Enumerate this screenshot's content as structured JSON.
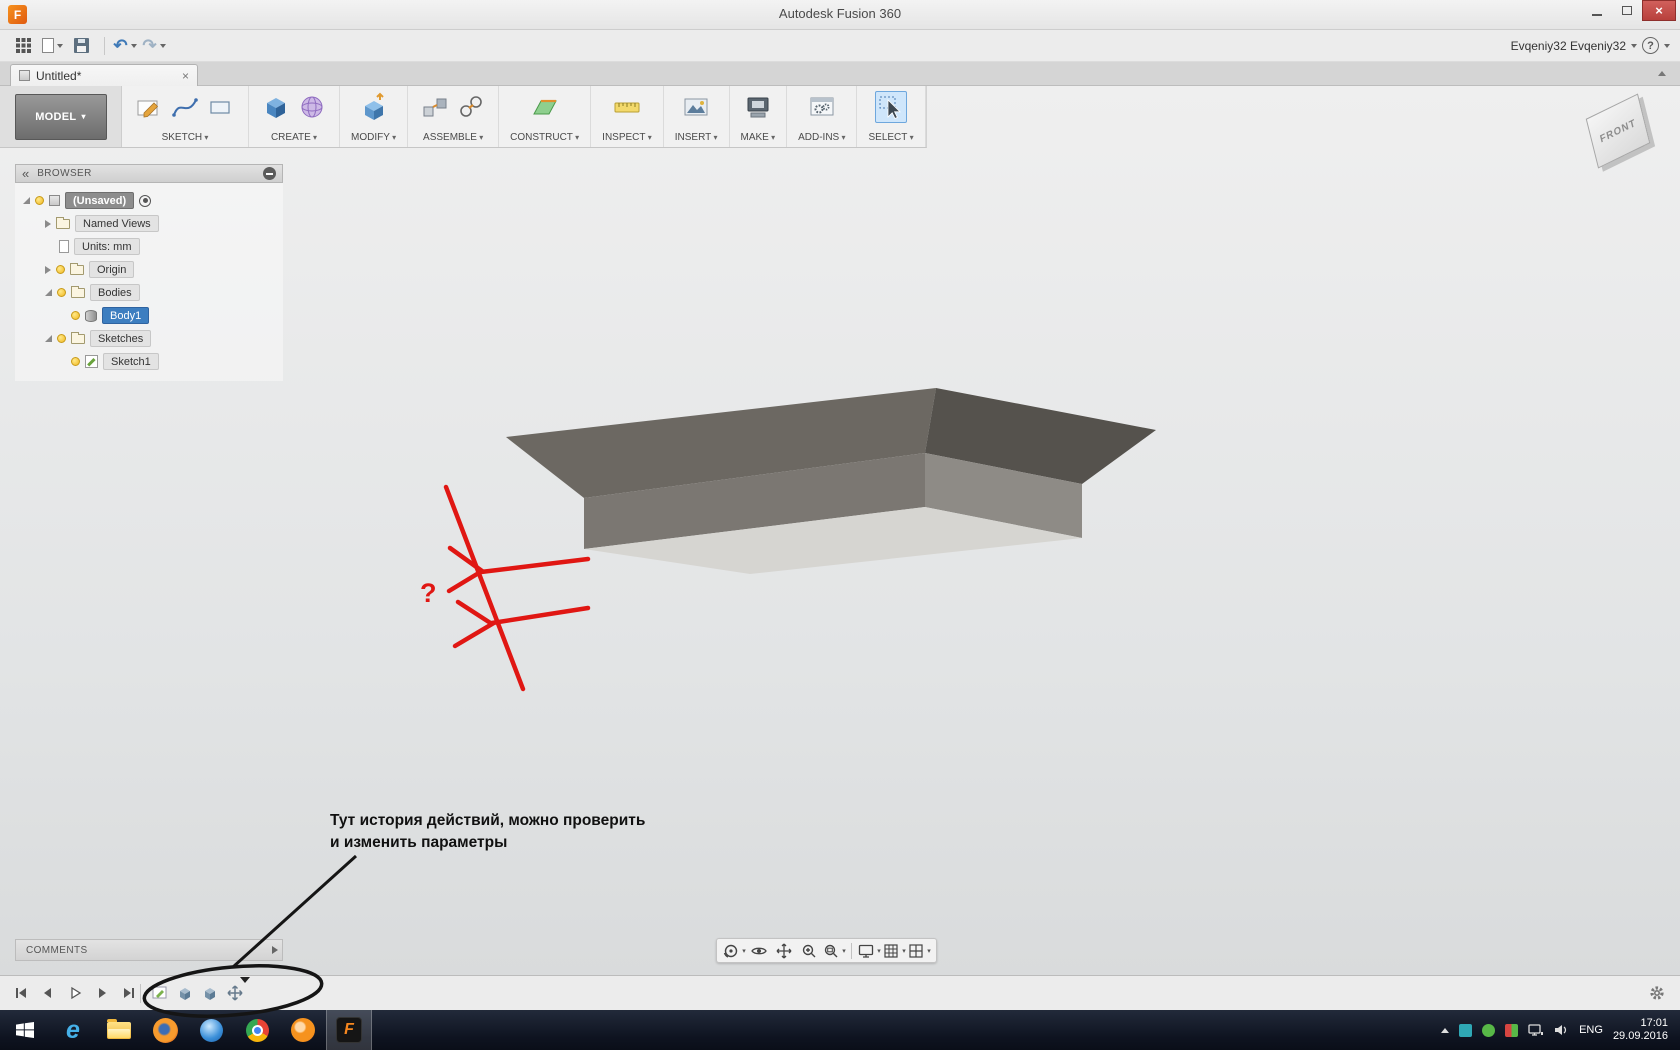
{
  "window": {
    "title": "Autodesk Fusion 360"
  },
  "qat": {
    "user": "Evqeniy32 Evqeniy32"
  },
  "tabs": [
    {
      "label": "Untitled*"
    }
  ],
  "ribbon": {
    "workspace": "MODEL",
    "groups": [
      {
        "label": "SKETCH"
      },
      {
        "label": "CREATE"
      },
      {
        "label": "MODIFY"
      },
      {
        "label": "ASSEMBLE"
      },
      {
        "label": "CONSTRUCT"
      },
      {
        "label": "INSPECT"
      },
      {
        "label": "INSERT"
      },
      {
        "label": "MAKE"
      },
      {
        "label": "ADD-INS"
      },
      {
        "label": "SELECT"
      }
    ]
  },
  "browser": {
    "title": "BROWSER",
    "items": [
      {
        "label": "(Unsaved)"
      },
      {
        "label": "Named Views"
      },
      {
        "label": "Units: mm"
      },
      {
        "label": "Origin"
      },
      {
        "label": "Bodies"
      },
      {
        "label": "Body1"
      },
      {
        "label": "Sketches"
      },
      {
        "label": "Sketch1"
      }
    ]
  },
  "canvas": {
    "viewcube_face": "FRONT",
    "question_mark": "?",
    "annotation_line1": "Тут история действий, можно проверить",
    "annotation_line2": "и изменить параметры",
    "body_colors": {
      "top_left": "#6c6862",
      "top_right": "#55524d",
      "wall_left": "#7b7772",
      "wall_right": "#8e8b86",
      "bottom": "#d6d5d1"
    },
    "annotation_color": "#e01713"
  },
  "comments": {
    "label": "COMMENTS"
  },
  "taskbar": {
    "language": "ENG",
    "time": "17:01",
    "date": "29.09.2016"
  }
}
